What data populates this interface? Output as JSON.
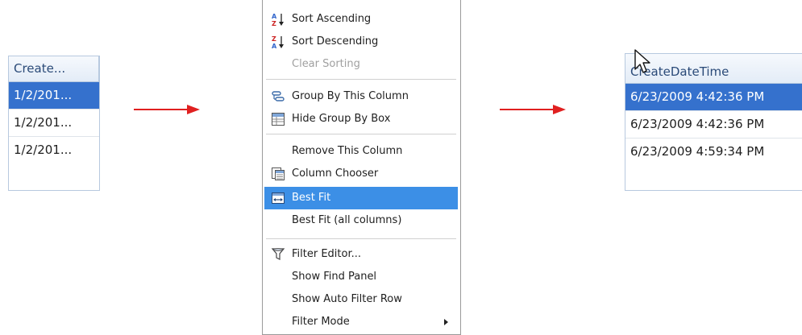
{
  "left_grid": {
    "header": "Create...",
    "rows": [
      "1/2/201...",
      "1/2/201...",
      "1/2/201..."
    ]
  },
  "context_menu": {
    "items": [
      {
        "label": "Sort Ascending",
        "icon": "sort-ascending-icon"
      },
      {
        "label": "Sort Descending",
        "icon": "sort-descending-icon"
      },
      {
        "label": "Clear Sorting",
        "disabled": true
      },
      {
        "label": "Group By This Column",
        "icon": "group-by-icon"
      },
      {
        "label": "Hide Group By Box",
        "icon": "group-box-icon"
      },
      {
        "label": "Remove This Column"
      },
      {
        "label": "Column Chooser",
        "icon": "column-chooser-icon"
      },
      {
        "label": "Best Fit",
        "icon": "best-fit-icon",
        "highlighted": true
      },
      {
        "label": "Best Fit (all columns)"
      },
      {
        "label": "Filter Editor...",
        "icon": "filter-icon"
      },
      {
        "label": "Show Find Panel"
      },
      {
        "label": "Show Auto Filter Row"
      },
      {
        "label": "Filter Mode",
        "has_submenu": true
      }
    ]
  },
  "right_grid": {
    "header": "CreateDateTime",
    "rows": [
      "6/23/2009 4:42:36 PM",
      "6/23/2009 4:42:36 PM",
      "6/23/2009 4:59:34 PM"
    ]
  },
  "colors": {
    "arrow": "#e02020",
    "selection": "#3571cd",
    "menu_highlight": "#3c8fe6"
  }
}
